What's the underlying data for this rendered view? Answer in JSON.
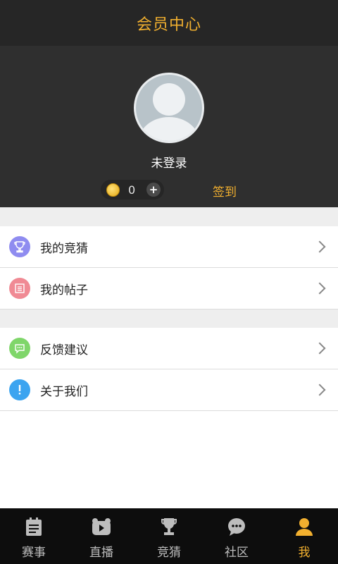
{
  "header": {
    "title": "会员中心"
  },
  "profile": {
    "status_text": "未登录",
    "coins": "0",
    "plus_glyph": "+",
    "checkin_label": "签到"
  },
  "menu": {
    "items": [
      {
        "label": "我的竞猜",
        "icon": "trophy-icon",
        "color": "#8f8cf0"
      },
      {
        "label": "我的帖子",
        "icon": "document-icon",
        "color": "#f08a94"
      },
      {
        "label": "反馈建议",
        "icon": "feedback-icon",
        "color": "#7fd66a"
      },
      {
        "label": "关于我们",
        "icon": "info-icon",
        "color": "#3ca4f0"
      }
    ]
  },
  "tabbar": {
    "items": [
      {
        "label": "赛事",
        "icon": "schedule-icon"
      },
      {
        "label": "直播",
        "icon": "live-icon"
      },
      {
        "label": "竞猜",
        "icon": "trophy-icon"
      },
      {
        "label": "社区",
        "icon": "chat-icon"
      },
      {
        "label": "我",
        "icon": "user-icon",
        "active": true
      }
    ]
  },
  "colors": {
    "accent": "#f2b02f",
    "dark": "#2f2f2f"
  }
}
